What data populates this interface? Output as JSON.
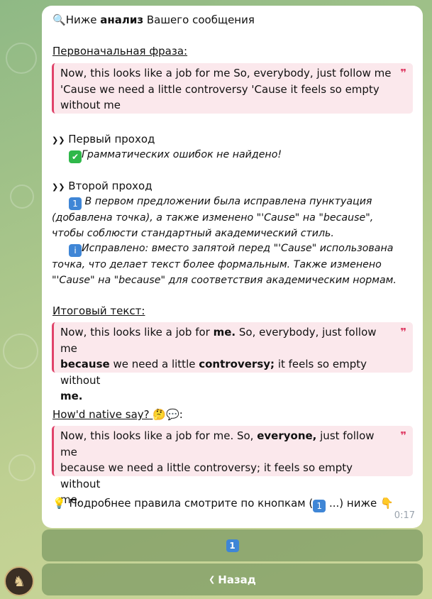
{
  "header": {
    "icon": "magnifier",
    "before": "Ниже ",
    "bold": "анализ",
    "after": " Вашего сообщения"
  },
  "original": {
    "label": "Первоначальная фраза:",
    "line1": "Now, this looks like a job for me So, everybody, just follow me",
    "line2": "'Cause we need a little controversy 'Cause it feels so empty",
    "line3": "without me"
  },
  "first_pass": {
    "marker": "❯❯",
    "title": "Первый проход",
    "result": "Грамматических ошибок не найдено!"
  },
  "second_pass": {
    "marker": "❯❯",
    "title": "Второй проход",
    "badge1": "1",
    "p1_line1": " В первом предложении была исправлена пунктуация",
    "p1_line2": "(добавлена точка), а также изменено \"'Cause\" на \"because\",",
    "p1_line3": "чтобы соблюсти стандартный академический стиль.",
    "badge2": "i",
    "p2_line1": "Исправлено: вместо запятой перед \"'Cause\" использована",
    "p2_line2": "точка, что делает текст более формальным. Также изменено",
    "p2_line3": "\"'Cause\" на \"because\" для соответствия академическим нормам."
  },
  "final": {
    "label": "Итоговый текст:",
    "a": "Now, this looks like a job for ",
    "b": "me.",
    "c": " So, everybody, just follow me",
    "d": "because",
    "e": " we need a little ",
    "f": "controversy;",
    "g": " it feels so empty without",
    "h": "me."
  },
  "native": {
    "label": "How'd native say?",
    "emoji": "🤔💬",
    "colon": ":",
    "a": "Now, this looks like a job for me. So, ",
    "b": "everyone,",
    "c": " just follow me",
    "line2": "because we need a little controversy; it feels so empty without",
    "line3": "me."
  },
  "footer": {
    "bulb": "💡",
    "text_before": " Подробнее правила смотрите по кнопкам (",
    "badge": "1",
    "text_after": " ...) ниже ",
    "pointer": "👇",
    "time": "0:17"
  },
  "keyboard": {
    "button1": "1",
    "back_arrow": "❮",
    "back_label": "Назад"
  },
  "colors": {
    "quote_accent": "#e0436a",
    "quote_bg": "#fbe8ec",
    "badge_blue": "#3f86d6",
    "check_green": "#2fb84a"
  }
}
